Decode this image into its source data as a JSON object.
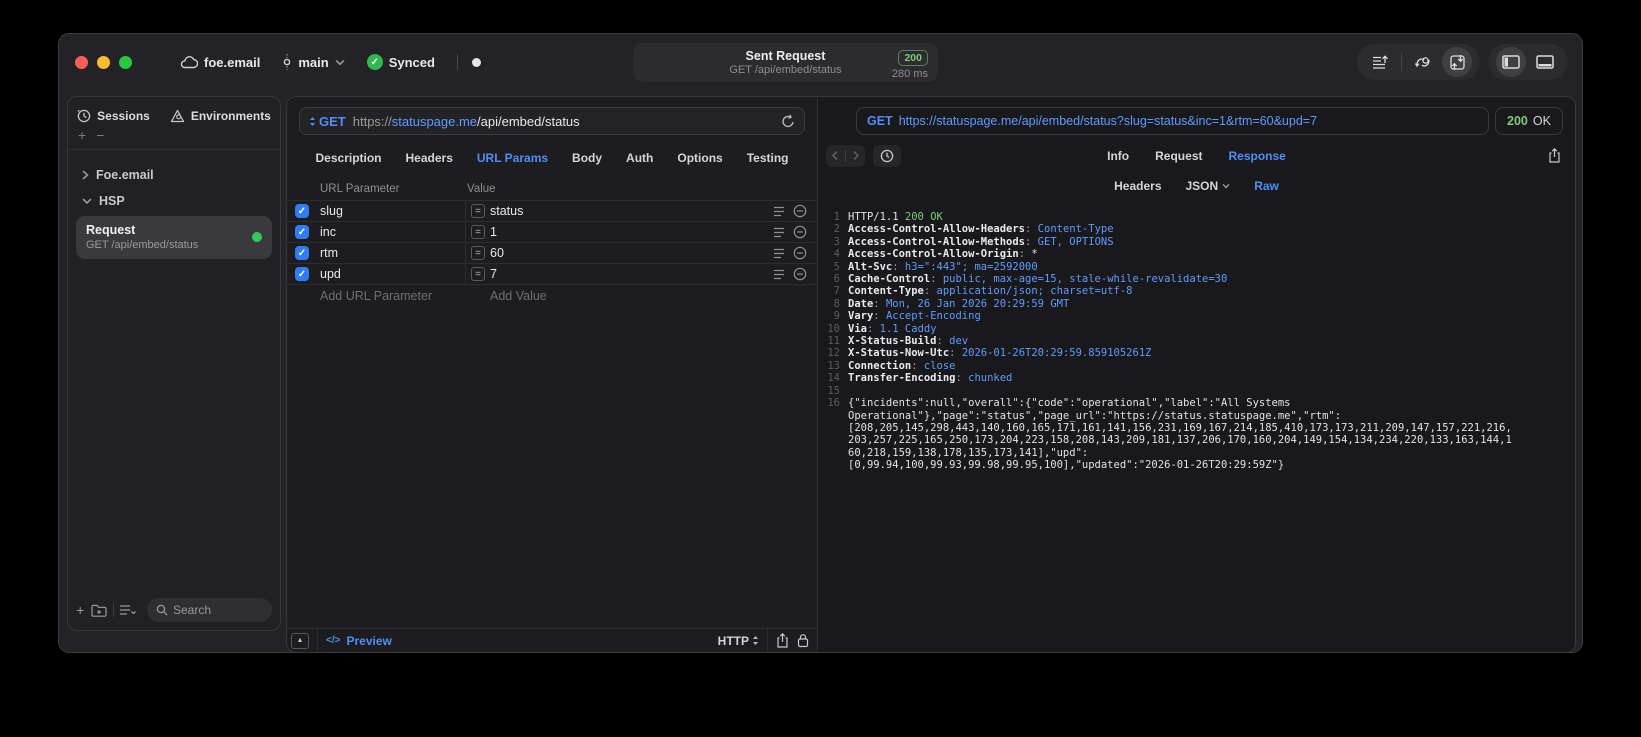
{
  "colors": {
    "accent_blue": "#4f8ef7",
    "value_blue": "#5d9bff",
    "success_green": "#7cc97c",
    "status_dot_green": "#34c759",
    "checkbox_blue": "#2f7cf6",
    "traffic_red": "#ff5f57",
    "traffic_yellow": "#febc2e",
    "traffic_green": "#28c840"
  },
  "icons": {
    "check": "✓",
    "equals": "=",
    "plus": "+",
    "minus": "−",
    "code_slash": "</>",
    "collapse_triangle": "▲"
  },
  "titlebar": {
    "project": "foe.email",
    "branch": "main",
    "sync_label": "Synced",
    "request_summary": {
      "title": "Sent Request",
      "method_path": "GET /api/embed/status",
      "status_code": "200",
      "duration": "280 ms"
    }
  },
  "sidebar": {
    "tabs": [
      {
        "label": "Sessions",
        "icon": "clock-icon"
      },
      {
        "label": "Environments",
        "icon": "environments-icon"
      }
    ],
    "tree": [
      {
        "label": "Foe.email",
        "expanded": false
      },
      {
        "label": "HSP",
        "expanded": true
      }
    ],
    "request_item": {
      "title": "Request",
      "subtitle": "GET /api/embed/status",
      "status": "success"
    },
    "search_placeholder": "Search"
  },
  "request_panel": {
    "method": "GET",
    "url": {
      "scheme": "https://",
      "host": "statuspage.me",
      "path": "/api/embed/status"
    },
    "tabs": [
      "Description",
      "Headers",
      "URL Params",
      "Body",
      "Auth",
      "Options",
      "Testing"
    ],
    "active_tab": "URL Params",
    "params": {
      "columns": [
        "URL Parameter",
        "Value"
      ],
      "rows": [
        {
          "name": "slug",
          "value": "status",
          "enabled": true
        },
        {
          "name": "inc",
          "value": "1",
          "enabled": true
        },
        {
          "name": "rtm",
          "value": "60",
          "enabled": true
        },
        {
          "name": "upd",
          "value": "7",
          "enabled": true
        }
      ],
      "add_name_placeholder": "Add URL Parameter",
      "add_value_placeholder": "Add Value"
    },
    "footer": {
      "preview_label": "Preview",
      "protocol_label": "HTTP"
    }
  },
  "response_panel": {
    "request_line": {
      "method": "GET",
      "url": "https://statuspage.me/api/embed/status?slug=status&inc=1&rtm=60&upd=7"
    },
    "status": {
      "code": "200",
      "text": "OK"
    },
    "tabs": [
      "Info",
      "Request",
      "Response"
    ],
    "active_tab": "Response",
    "view_tabs": {
      "headers": "Headers",
      "format": "JSON",
      "raw": "Raw",
      "active": "Raw"
    },
    "body_lines": [
      {
        "num": "1",
        "segs": [
          [
            "pl",
            "HTTP/1.1 "
          ],
          [
            "gr",
            "200 OK"
          ]
        ]
      },
      {
        "num": "2",
        "segs": [
          [
            "hn",
            "Access-Control-Allow-Headers"
          ],
          [
            "pc",
            ": "
          ],
          [
            "hv",
            "Content-Type"
          ]
        ]
      },
      {
        "num": "3",
        "segs": [
          [
            "hn",
            "Access-Control-Allow-Methods"
          ],
          [
            "pc",
            ": "
          ],
          [
            "hv",
            "GET, OPTIONS"
          ]
        ]
      },
      {
        "num": "4",
        "segs": [
          [
            "hn",
            "Access-Control-Allow-Origin"
          ],
          [
            "pc",
            ": "
          ],
          [
            "pl",
            "*"
          ]
        ]
      },
      {
        "num": "5",
        "segs": [
          [
            "hn",
            "Alt-Svc"
          ],
          [
            "pc",
            ": "
          ],
          [
            "hv",
            "h3=\":443\"; ma=2592000"
          ]
        ]
      },
      {
        "num": "6",
        "segs": [
          [
            "hn",
            "Cache-Control"
          ],
          [
            "pc",
            ": "
          ],
          [
            "hv",
            "public, max-age=15, stale-while-revalidate=30"
          ]
        ]
      },
      {
        "num": "7",
        "segs": [
          [
            "hn",
            "Content-Type"
          ],
          [
            "pc",
            ": "
          ],
          [
            "hv",
            "application/json; charset=utf-8"
          ]
        ]
      },
      {
        "num": "8",
        "segs": [
          [
            "hn",
            "Date"
          ],
          [
            "pc",
            ": "
          ],
          [
            "hv",
            "Mon, 26 Jan 2026 20:29:59 GMT"
          ]
        ]
      },
      {
        "num": "9",
        "segs": [
          [
            "hn",
            "Vary"
          ],
          [
            "pc",
            ": "
          ],
          [
            "hv",
            "Accept-Encoding"
          ]
        ]
      },
      {
        "num": "10",
        "segs": [
          [
            "hn",
            "Via"
          ],
          [
            "pc",
            ": "
          ],
          [
            "hv",
            "1.1 Caddy"
          ]
        ]
      },
      {
        "num": "11",
        "segs": [
          [
            "hn",
            "X-Status-Build"
          ],
          [
            "pc",
            ": "
          ],
          [
            "hv",
            "dev"
          ]
        ]
      },
      {
        "num": "12",
        "segs": [
          [
            "hn",
            "X-Status-Now-Utc"
          ],
          [
            "pc",
            ": "
          ],
          [
            "hv",
            "2026-01-26T20:29:59.859105261Z"
          ]
        ]
      },
      {
        "num": "13",
        "segs": [
          [
            "hn",
            "Connection"
          ],
          [
            "pc",
            ": "
          ],
          [
            "hv",
            "close"
          ]
        ]
      },
      {
        "num": "14",
        "segs": [
          [
            "hn",
            "Transfer-Encoding"
          ],
          [
            "pc",
            ": "
          ],
          [
            "hv",
            "chunked"
          ]
        ]
      },
      {
        "num": "15",
        "segs": []
      },
      {
        "num": "16",
        "segs": [
          [
            "pl",
            "{\"incidents\":null,\"overall\":{\"code\":\"operational\",\"label\":\"All Systems\nOperational\"},\"page\":\"status\",\"page_url\":\"https://status.statuspage.me\",\"rtm\":\n[208,205,145,298,443,140,160,165,171,161,141,156,231,169,167,214,185,410,173,173,211,209,147,157,221,216,\n203,257,225,165,250,173,204,223,158,208,143,209,181,137,206,170,160,204,149,154,134,234,220,133,163,144,1\n60,218,159,138,178,135,173,141],\"upd\":\n[0,99.94,100,99.93,99.98,99.95,100],\"updated\":\"2026-01-26T20:29:59Z\"}"
          ]
        ]
      }
    ]
  }
}
